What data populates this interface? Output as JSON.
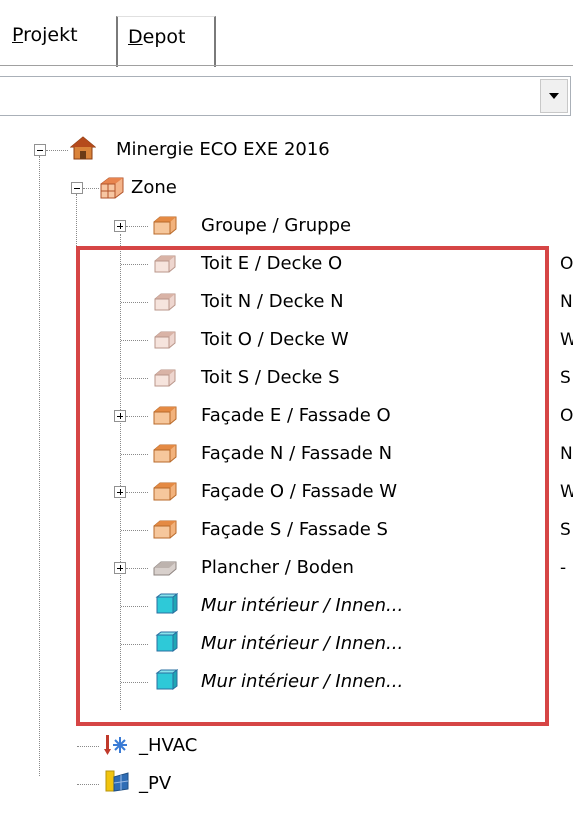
{
  "tabs": [
    {
      "label": "Projekt",
      "accel_index": 0
    },
    {
      "label": "Depot",
      "accel_index": 0
    }
  ],
  "combo": {
    "value": ""
  },
  "tree": {
    "root": {
      "label": "Minergie ECO EXE 2016"
    },
    "zone": {
      "label": "Zone"
    },
    "items": [
      {
        "label": "Groupe / Gruppe",
        "trail": "",
        "expander": true
      },
      {
        "label": "Toit E / Decke O",
        "trail": "O",
        "expander": false
      },
      {
        "label": "Toit N / Decke  N",
        "trail": "N",
        "expander": false
      },
      {
        "label": "Toit O / Decke W",
        "trail": "W",
        "expander": false
      },
      {
        "label": "Toit S / Decke S",
        "trail": "S",
        "expander": false
      },
      {
        "label": "Façade E / Fassade O",
        "trail": "O",
        "expander": true
      },
      {
        "label": "Façade N / Fassade  N",
        "trail": "N",
        "expander": false
      },
      {
        "label": "Façade O / Fassade  W",
        "trail": "W",
        "expander": true
      },
      {
        "label": "Façade S / Fassade S",
        "trail": "S",
        "expander": false
      },
      {
        "label": "Plancher / Boden",
        "trail": "-",
        "expander": true
      },
      {
        "label": "Mur intérieur / Innen...",
        "trail": "",
        "expander": false
      },
      {
        "label": "Mur intérieur / Innen...",
        "trail": "",
        "expander": false
      },
      {
        "label": "Mur intérieur / Innen...",
        "trail": "",
        "expander": false
      }
    ],
    "hvac": {
      "label": "_HVAC"
    },
    "pv": {
      "label": "_PV"
    }
  }
}
